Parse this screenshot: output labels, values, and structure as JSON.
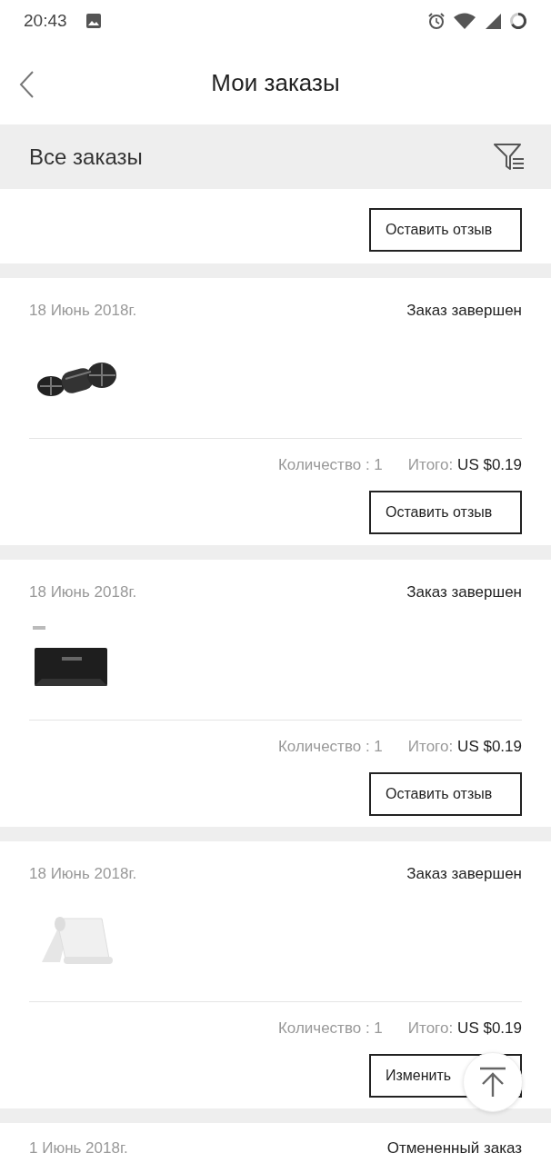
{
  "status_bar": {
    "time": "20:43"
  },
  "header": {
    "title": "Мои заказы"
  },
  "filter_bar": {
    "label": "Все заказы"
  },
  "top_card": {
    "button": "Оставить отзыв"
  },
  "orders": [
    {
      "date": "18 Июнь 2018г.",
      "status": "Заказ завершен",
      "quantity": "Количество : 1",
      "total_label": "Итого:",
      "total": "US $0.19",
      "button": "Оставить отзыв"
    },
    {
      "date": "18 Июнь 2018г.",
      "status": "Заказ завершен",
      "quantity": "Количество : 1",
      "total_label": "Итого:",
      "total": "US $0.19",
      "button": "Оставить отзыв"
    },
    {
      "date": "18 Июнь 2018г.",
      "status": "Заказ завершен",
      "quantity": "Количество : 1",
      "total_label": "Итого:",
      "total": "US $0.19",
      "button": "Изменить"
    },
    {
      "date": "1 Июнь 2018г.",
      "status": "Отмененный заказ"
    }
  ]
}
